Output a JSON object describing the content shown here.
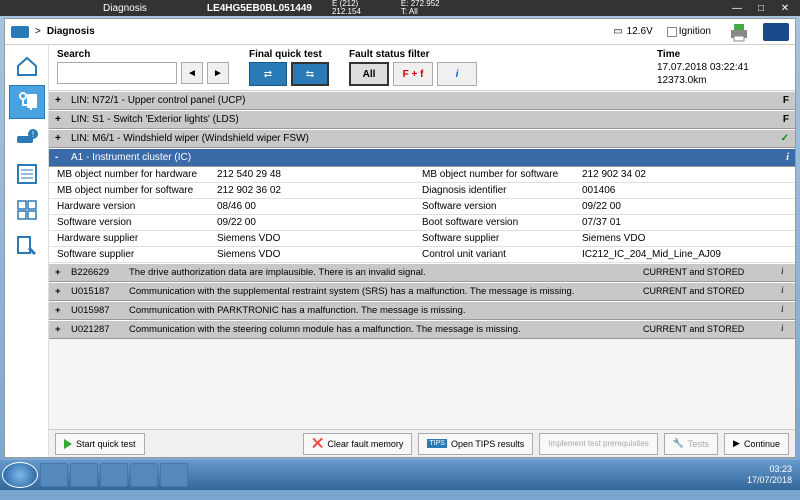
{
  "titlebar": {
    "title": "Diagnosis",
    "vin": "LE4HG5EB0BL051449",
    "codes1": "E (212)\n212.154",
    "codes2": "E: 272.952\nT: All"
  },
  "breadcrumb": {
    "diag": "Diagnosis",
    "voltage": "12.6V",
    "ignition": "Ignition"
  },
  "filters": {
    "search_label": "Search",
    "quick_label": "Final quick test",
    "fault_label": "Fault status filter",
    "all": "All",
    "ff": "F + f",
    "info": "i",
    "time_label": "Time",
    "time": "17.07.2018 03:22:41",
    "km": "12373.0km"
  },
  "ecus": [
    {
      "exp": "+",
      "name": "LIN: N72/1 - Upper control panel (UCP)",
      "status": "F",
      "ok": false
    },
    {
      "exp": "+",
      "name": "LIN: S1 - Switch 'Exterior lights' (LDS)",
      "status": "F",
      "ok": false
    },
    {
      "exp": "+",
      "name": "LIN: M6/1 - Windshield wiper (Windshield wiper FSW)",
      "status": "✓",
      "ok": true
    }
  ],
  "expanded": {
    "exp": "-",
    "name": "A1 - Instrument cluster (IC)",
    "info": "i"
  },
  "details": [
    {
      "k1": "MB object number for hardware",
      "v1": "212 540 29 48",
      "k2": "MB object number for software",
      "v2": "212 902 34 02"
    },
    {
      "k1": "MB object number for software",
      "v1": "212 902 36 02",
      "k2": "Diagnosis identifier",
      "v2": "001406"
    },
    {
      "k1": "Hardware version",
      "v1": "08/46 00",
      "k2": "Software version",
      "v2": "09/22 00"
    },
    {
      "k1": "Software version",
      "v1": "09/22 00",
      "k2": "Boot software version",
      "v2": "07/37 01"
    },
    {
      "k1": "Hardware supplier",
      "v1": "Siemens VDO",
      "k2": "Software supplier",
      "v2": "Siemens VDO"
    },
    {
      "k1": "Software supplier",
      "v1": "Siemens VDO",
      "k2": "Control unit variant",
      "v2": "IC212_IC_204_Mid_Line_AJ09"
    }
  ],
  "faults": [
    {
      "code": "B226629",
      "desc": "The drive authorization data are implausible. There is an invalid signal.",
      "status": "CURRENT and STORED"
    },
    {
      "code": "U015187",
      "desc": "Communication with the supplemental restraint system (SRS) has a malfunction. The message is missing.",
      "status": "CURRENT and STORED"
    },
    {
      "code": "U015987",
      "desc": "Communication with PARKTRONIC has a malfunction. The message is missing.",
      "status": ""
    },
    {
      "code": "U021287",
      "desc": "Communication with the steering column module has a malfunction. The message is missing.",
      "status": "CURRENT and STORED"
    }
  ],
  "footer": {
    "start": "Start quick test",
    "clear": "Clear fault memory",
    "tips": "Open TIPS results",
    "impl": "Implement test prerequisites",
    "tests": "Tests",
    "cont": "Continue",
    "tips_badge": "TIPS"
  },
  "taskbar": {
    "time": "03:23",
    "date": "17/07/2018"
  }
}
